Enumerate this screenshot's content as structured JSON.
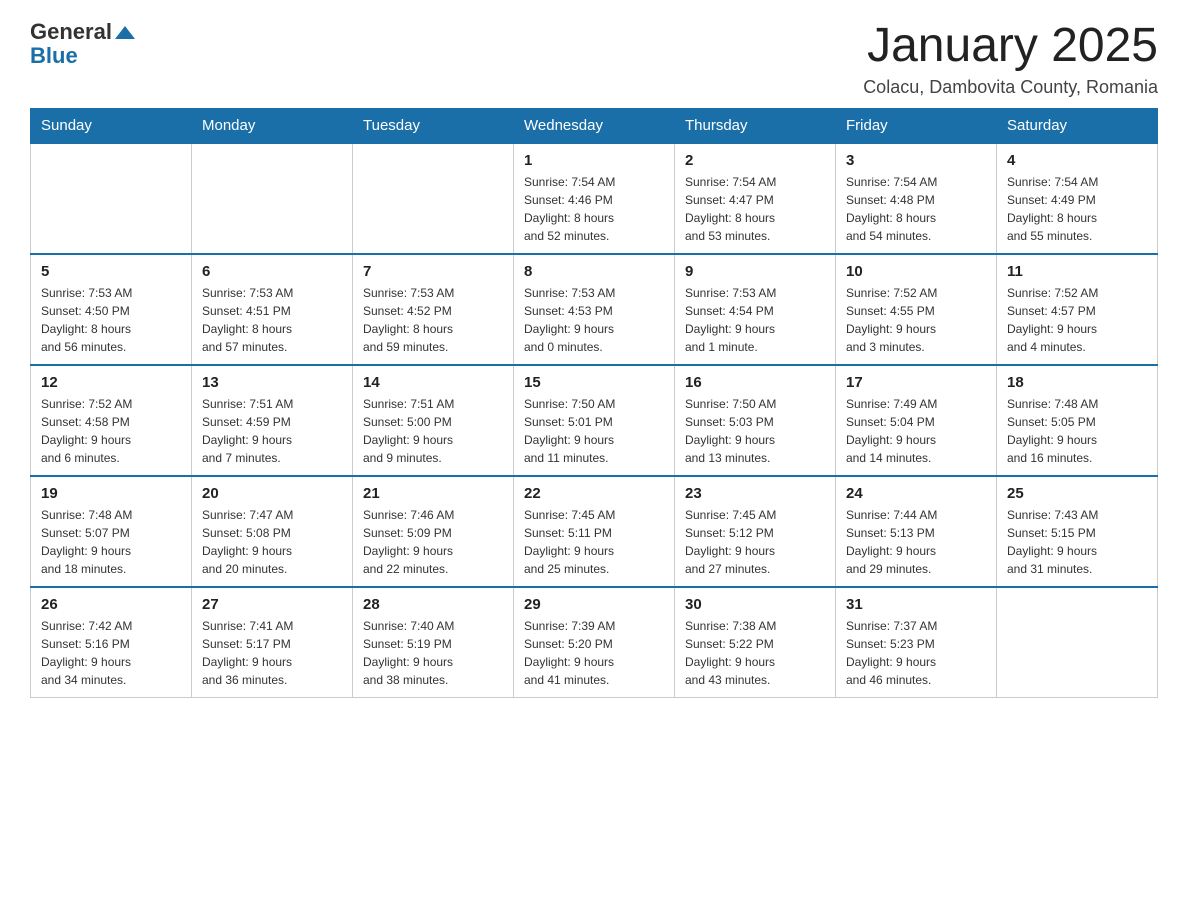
{
  "header": {
    "logo": {
      "general": "General",
      "blue": "Blue"
    },
    "title": "January 2025",
    "subtitle": "Colacu, Dambovita County, Romania"
  },
  "weekdays": [
    "Sunday",
    "Monday",
    "Tuesday",
    "Wednesday",
    "Thursday",
    "Friday",
    "Saturday"
  ],
  "weeks": [
    [
      {
        "day": "",
        "info": ""
      },
      {
        "day": "",
        "info": ""
      },
      {
        "day": "",
        "info": ""
      },
      {
        "day": "1",
        "info": "Sunrise: 7:54 AM\nSunset: 4:46 PM\nDaylight: 8 hours\nand 52 minutes."
      },
      {
        "day": "2",
        "info": "Sunrise: 7:54 AM\nSunset: 4:47 PM\nDaylight: 8 hours\nand 53 minutes."
      },
      {
        "day": "3",
        "info": "Sunrise: 7:54 AM\nSunset: 4:48 PM\nDaylight: 8 hours\nand 54 minutes."
      },
      {
        "day": "4",
        "info": "Sunrise: 7:54 AM\nSunset: 4:49 PM\nDaylight: 8 hours\nand 55 minutes."
      }
    ],
    [
      {
        "day": "5",
        "info": "Sunrise: 7:53 AM\nSunset: 4:50 PM\nDaylight: 8 hours\nand 56 minutes."
      },
      {
        "day": "6",
        "info": "Sunrise: 7:53 AM\nSunset: 4:51 PM\nDaylight: 8 hours\nand 57 minutes."
      },
      {
        "day": "7",
        "info": "Sunrise: 7:53 AM\nSunset: 4:52 PM\nDaylight: 8 hours\nand 59 minutes."
      },
      {
        "day": "8",
        "info": "Sunrise: 7:53 AM\nSunset: 4:53 PM\nDaylight: 9 hours\nand 0 minutes."
      },
      {
        "day": "9",
        "info": "Sunrise: 7:53 AM\nSunset: 4:54 PM\nDaylight: 9 hours\nand 1 minute."
      },
      {
        "day": "10",
        "info": "Sunrise: 7:52 AM\nSunset: 4:55 PM\nDaylight: 9 hours\nand 3 minutes."
      },
      {
        "day": "11",
        "info": "Sunrise: 7:52 AM\nSunset: 4:57 PM\nDaylight: 9 hours\nand 4 minutes."
      }
    ],
    [
      {
        "day": "12",
        "info": "Sunrise: 7:52 AM\nSunset: 4:58 PM\nDaylight: 9 hours\nand 6 minutes."
      },
      {
        "day": "13",
        "info": "Sunrise: 7:51 AM\nSunset: 4:59 PM\nDaylight: 9 hours\nand 7 minutes."
      },
      {
        "day": "14",
        "info": "Sunrise: 7:51 AM\nSunset: 5:00 PM\nDaylight: 9 hours\nand 9 minutes."
      },
      {
        "day": "15",
        "info": "Sunrise: 7:50 AM\nSunset: 5:01 PM\nDaylight: 9 hours\nand 11 minutes."
      },
      {
        "day": "16",
        "info": "Sunrise: 7:50 AM\nSunset: 5:03 PM\nDaylight: 9 hours\nand 13 minutes."
      },
      {
        "day": "17",
        "info": "Sunrise: 7:49 AM\nSunset: 5:04 PM\nDaylight: 9 hours\nand 14 minutes."
      },
      {
        "day": "18",
        "info": "Sunrise: 7:48 AM\nSunset: 5:05 PM\nDaylight: 9 hours\nand 16 minutes."
      }
    ],
    [
      {
        "day": "19",
        "info": "Sunrise: 7:48 AM\nSunset: 5:07 PM\nDaylight: 9 hours\nand 18 minutes."
      },
      {
        "day": "20",
        "info": "Sunrise: 7:47 AM\nSunset: 5:08 PM\nDaylight: 9 hours\nand 20 minutes."
      },
      {
        "day": "21",
        "info": "Sunrise: 7:46 AM\nSunset: 5:09 PM\nDaylight: 9 hours\nand 22 minutes."
      },
      {
        "day": "22",
        "info": "Sunrise: 7:45 AM\nSunset: 5:11 PM\nDaylight: 9 hours\nand 25 minutes."
      },
      {
        "day": "23",
        "info": "Sunrise: 7:45 AM\nSunset: 5:12 PM\nDaylight: 9 hours\nand 27 minutes."
      },
      {
        "day": "24",
        "info": "Sunrise: 7:44 AM\nSunset: 5:13 PM\nDaylight: 9 hours\nand 29 minutes."
      },
      {
        "day": "25",
        "info": "Sunrise: 7:43 AM\nSunset: 5:15 PM\nDaylight: 9 hours\nand 31 minutes."
      }
    ],
    [
      {
        "day": "26",
        "info": "Sunrise: 7:42 AM\nSunset: 5:16 PM\nDaylight: 9 hours\nand 34 minutes."
      },
      {
        "day": "27",
        "info": "Sunrise: 7:41 AM\nSunset: 5:17 PM\nDaylight: 9 hours\nand 36 minutes."
      },
      {
        "day": "28",
        "info": "Sunrise: 7:40 AM\nSunset: 5:19 PM\nDaylight: 9 hours\nand 38 minutes."
      },
      {
        "day": "29",
        "info": "Sunrise: 7:39 AM\nSunset: 5:20 PM\nDaylight: 9 hours\nand 41 minutes."
      },
      {
        "day": "30",
        "info": "Sunrise: 7:38 AM\nSunset: 5:22 PM\nDaylight: 9 hours\nand 43 minutes."
      },
      {
        "day": "31",
        "info": "Sunrise: 7:37 AM\nSunset: 5:23 PM\nDaylight: 9 hours\nand 46 minutes."
      },
      {
        "day": "",
        "info": ""
      }
    ]
  ]
}
